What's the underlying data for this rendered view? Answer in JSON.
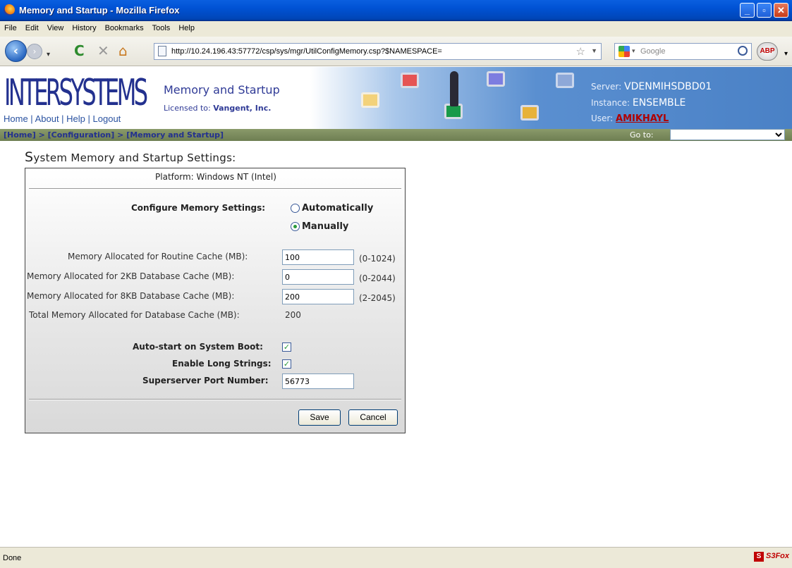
{
  "window": {
    "title": "Memory and Startup - Mozilla Firefox"
  },
  "menu": [
    "File",
    "Edit",
    "View",
    "History",
    "Bookmarks",
    "Tools",
    "Help"
  ],
  "toolbar": {
    "url": "http://10.24.196.43:57772/csp/sys/mgr/UtilConfigMemory.csp?$NAMESPACE=",
    "search_placeholder": "Google",
    "abp_label": "ABP"
  },
  "header": {
    "logo": "INTERSYSTEMS",
    "links": [
      "Home",
      "About",
      "Help",
      "Logout"
    ],
    "page_title": "Memory and Startup",
    "licensed_label": "Licensed to:",
    "licensed_to": "Vangent, Inc.",
    "server_label": "Server:",
    "server": "VDENMIHSDBD01",
    "instance_label": "Instance:",
    "instance": "ENSEMBLE",
    "user_label": "User:",
    "user": "AMIKHAYL"
  },
  "breadcrumb": {
    "home": "[Home]",
    "sep": ">",
    "configuration": "[Configuration]",
    "current": "[Memory and Startup]",
    "goto_label": "Go to:"
  },
  "section": {
    "title_first": "S",
    "title_rest": "ystem Memory and Startup Settings:"
  },
  "form": {
    "platform": "Platform: Windows NT (Intel)",
    "configure_label": "Configure Memory Settings:",
    "auto_label": "Automatically",
    "manual_label": "Manually",
    "selected_mode": "Manually",
    "routine_label": "Memory Allocated for Routine Cache (MB):",
    "routine_value": "100",
    "routine_range": "(0-1024)",
    "db2kb_label": "Memory Allocated for 2KB Database Cache (MB):",
    "db2kb_value": "0",
    "db2kb_range": "(0-2044)",
    "db8kb_label": "Memory Allocated for 8KB Database Cache (MB):",
    "db8kb_value": "200",
    "db8kb_range": "(2-2045)",
    "total_label": "Total Memory Allocated for Database Cache (MB):",
    "total_value": "200",
    "autostart_label": "Auto-start on System Boot:",
    "autostart": true,
    "longstrings_label": "Enable Long Strings:",
    "longstrings": true,
    "port_label": "Superserver Port Number:",
    "port_value": "56773",
    "save_label": "Save",
    "cancel_label": "Cancel"
  },
  "status": {
    "text": "Done",
    "addon": "S3Fox"
  },
  "colors": {
    "title_blue": "#0054e3",
    "brand_navy": "#23318f",
    "user_red": "#b00000",
    "crumb_bar": "#7a8a5c"
  }
}
